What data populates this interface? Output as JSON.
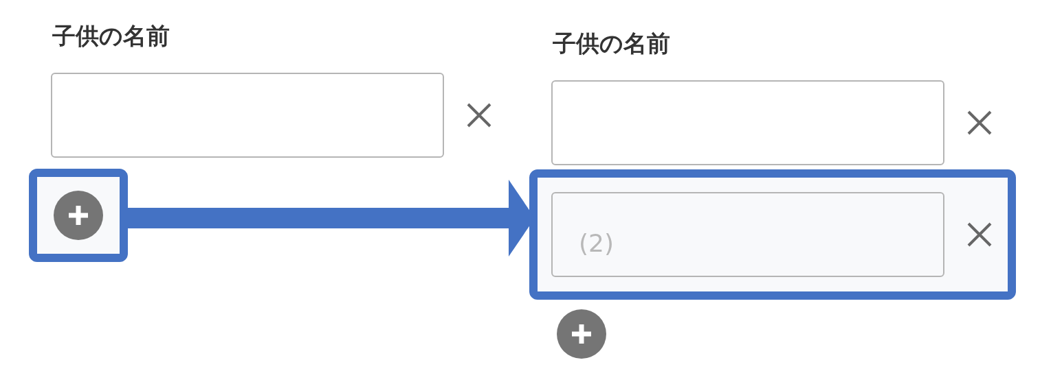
{
  "panels": [
    {
      "label": "子供の名前",
      "fields": [
        {
          "highlighted": false
        }
      ],
      "add_button": {
        "highlighted": true
      }
    },
    {
      "label": "子供の名前",
      "fields": [
        {
          "highlighted": false
        },
        {
          "highlighted": true,
          "placeholder": "(2)"
        }
      ],
      "add_button": {
        "highlighted": false
      }
    }
  ]
}
